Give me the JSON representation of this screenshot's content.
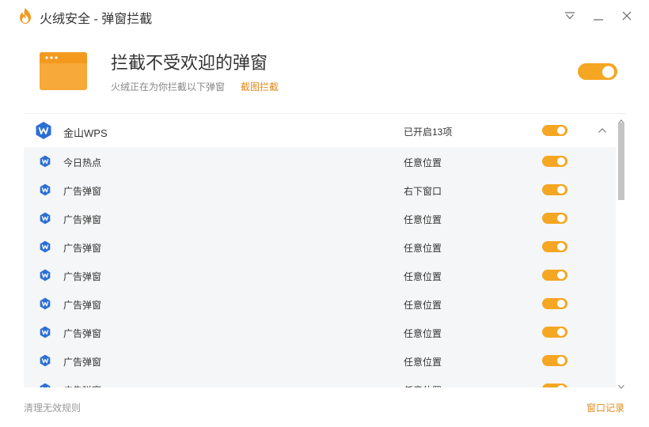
{
  "window": {
    "title": "火绒安全 - 弹窗拦截"
  },
  "colors": {
    "accent": "#f5a623",
    "link": "#e08a1e",
    "row_bg": "#f5f6f7",
    "wps_blue": "#2b6fd6"
  },
  "header": {
    "title": "拦截不受欢迎的弹窗",
    "subtitle": "火绒正在为你拦截以下弹窗",
    "screenshot_link": "截图拦截",
    "master_toggle_on": true
  },
  "list": {
    "group": {
      "name": "金山WPS",
      "status": "已开启13项",
      "enabled": true,
      "expanded": true,
      "icon": "wps-icon"
    },
    "items": [
      {
        "name": "今日热点",
        "position": "任意位置",
        "enabled": true
      },
      {
        "name": "广告弹窗",
        "position": "右下窗口",
        "enabled": true
      },
      {
        "name": "广告弹窗",
        "position": "任意位置",
        "enabled": true
      },
      {
        "name": "广告弹窗",
        "position": "任意位置",
        "enabled": true
      },
      {
        "name": "广告弹窗",
        "position": "任意位置",
        "enabled": true
      },
      {
        "name": "广告弹窗",
        "position": "任意位置",
        "enabled": true
      },
      {
        "name": "广告弹窗",
        "position": "任意位置",
        "enabled": true
      },
      {
        "name": "广告弹窗",
        "position": "任意位置",
        "enabled": true
      },
      {
        "name": "广告弹窗",
        "position": "任意位置",
        "enabled": true
      }
    ]
  },
  "footer": {
    "clean_rules": "清理无效规则",
    "window_log": "窗口记录"
  }
}
